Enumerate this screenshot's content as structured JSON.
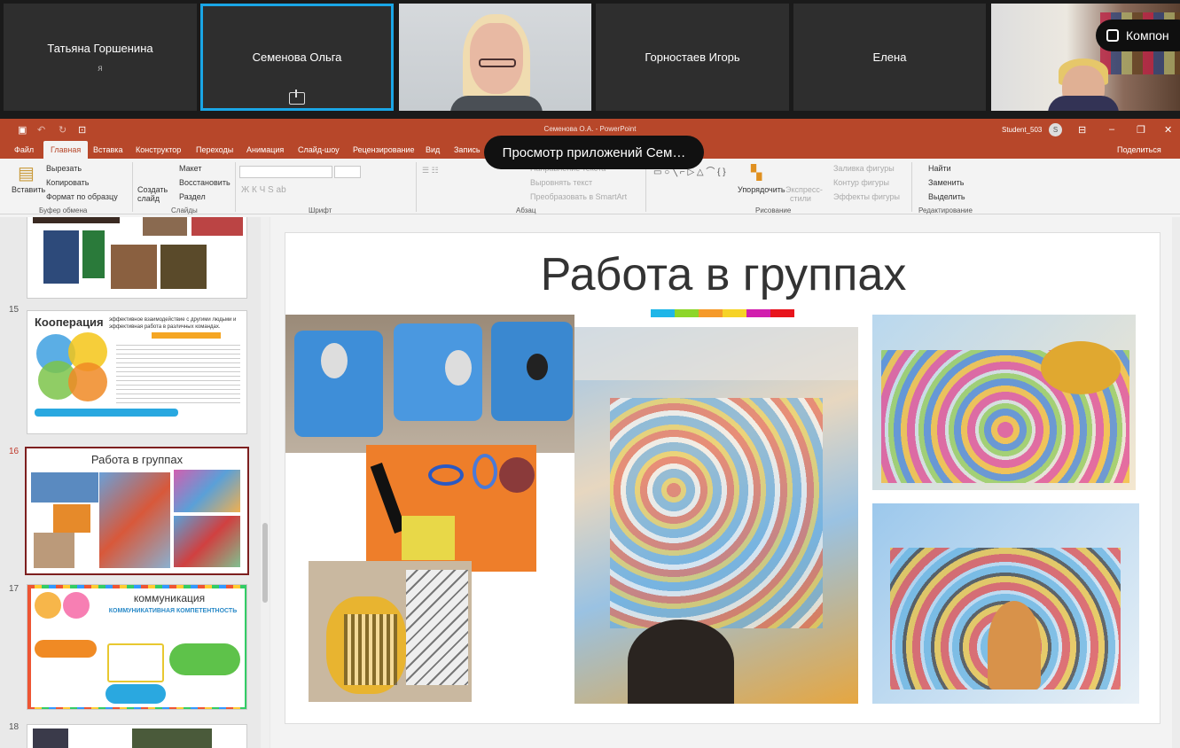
{
  "participants": [
    {
      "name": "Татьяна Горшенина",
      "sub": "я"
    },
    {
      "name": "Семенова Ольга"
    },
    {
      "name": ""
    },
    {
      "name": "Горностаев Игорь"
    },
    {
      "name": "Елена"
    }
  ],
  "badge_label": "Компон",
  "window": {
    "doc_title": "Семенова О.А.  -  PowerPoint",
    "user": "Student_503",
    "user_initial": "S"
  },
  "menu": [
    "Файл",
    "Главная",
    "Вставка",
    "Конструктор",
    "Переходы",
    "Анимация",
    "Слайд-шоу",
    "Рецензирование",
    "Вид",
    "Запись"
  ],
  "share_label": "Поделиться",
  "tooltip": "Просмотр приложений Сем…",
  "ribbon": {
    "paste": "Вставить",
    "cut": "Вырезать",
    "copy": "Копировать",
    "format_painter": "Формат по образцу",
    "clipboard": "Буфер обмена",
    "create_slide_1": "Создать",
    "create_slide_2": "слайд",
    "layout": "Макет",
    "reset": "Восстановить",
    "section": "Раздел",
    "slides": "Слайды",
    "font": "Шрифт",
    "text_direction": "Направление текста",
    "align_text": "Выровнять текст",
    "smartart": "Преобразовать в SmartArt",
    "paragraph": "Абзац",
    "arrange": "Упорядочить",
    "quick_styles_1": "Экспресс-",
    "quick_styles_2": "стили",
    "fill": "Заливка фигуры",
    "outline": "Контур фигуры",
    "effects": "Эффекты фигуры",
    "drawing": "Рисование",
    "find": "Найти",
    "replace": "Заменить",
    "select": "Выделить",
    "editing": "Редактирование"
  },
  "thumbnails": [
    {
      "num": "15",
      "title": "Кооперация",
      "subtitle": "эффективное взаимодействие с другими людьми и эффективная работа в различных командах."
    },
    {
      "num": "16",
      "title": "Работа в группах"
    },
    {
      "num": "17",
      "title": "коммуникация",
      "subtitle": "КОММУНИКАТИВНАЯ КОМПЕТЕНТНОСТЬ"
    },
    {
      "num": "18"
    }
  ],
  "slide": {
    "title": "Работа в группах",
    "bar_colors": [
      "#1fb6e8",
      "#8dd62a",
      "#f59a2a",
      "#f6d327",
      "#d11fae",
      "#e8141c"
    ]
  }
}
